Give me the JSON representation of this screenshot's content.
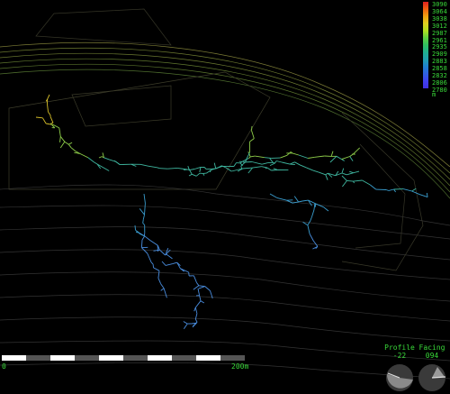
{
  "legend": {
    "labels": [
      "3090",
      "3064",
      "3038",
      "3012",
      "2987",
      "2961",
      "2935",
      "2909",
      "2883",
      "2858",
      "2832",
      "2806",
      "2780"
    ],
    "unit": "m",
    "colors": [
      "#e02020",
      "#f06010",
      "#f0a010",
      "#e0d020",
      "#b0e020",
      "#60d040",
      "#30c060",
      "#20b090",
      "#20a0b0",
      "#2080d0",
      "#3060e0",
      "#4040f0",
      "#4030e0"
    ]
  },
  "scalebar": {
    "start_label": "0",
    "end_label": "200m"
  },
  "gauges": {
    "profile": {
      "title": "Profile",
      "value": "-22"
    },
    "facing": {
      "title": "Facing",
      "value": "094"
    }
  }
}
